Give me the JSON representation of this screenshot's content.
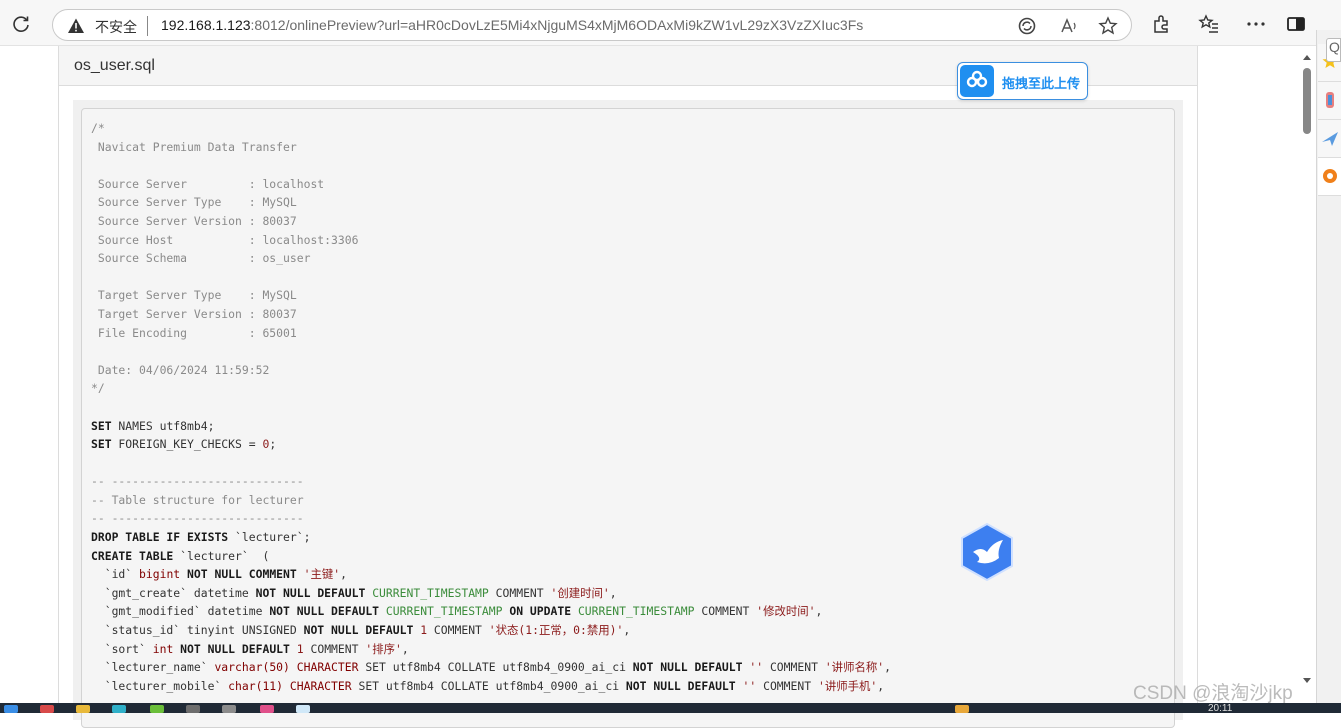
{
  "browser": {
    "security_label": "不安全",
    "url_host": "192.168.1.123",
    "url_rest": ":8012/onlinePreview?url=aHR0cDovLzE5Mi4xNjguMS4xMjM6ODAxMi9kZW1vL29zX3VzZXIuc3Fs",
    "side_search_text": "Q"
  },
  "page": {
    "file_title": "os_user.sql",
    "upload_label": "拖拽至此上传"
  },
  "code": {
    "l01": "/*",
    "l02": " Navicat Premium Data Transfer",
    "l03": "",
    "l04": " Source Server         : localhost",
    "l05": " Source Server Type    : MySQL",
    "l06": " Source Server Version : 80037",
    "l07": " Source Host           : localhost:3306",
    "l08": " Source Schema         : os_user",
    "l09": "",
    "l10": " Target Server Type    : MySQL",
    "l11": " Target Server Version : 80037",
    "l12": " File Encoding         : 65001",
    "l13": "",
    "l14": " Date: 04/06/2024 11:59:52",
    "l15": "*/",
    "set_names_kw": "SET",
    "set_names_rest": " NAMES utf8mb4;",
    "set_fk_kw": "SET",
    "set_fk_rest": " FOREIGN_KEY_CHECKS = ",
    "set_fk_val": "0",
    "set_fk_end": ";",
    "c1": "-- ----------------------------",
    "c2": "-- Table structure for lecturer",
    "c3": "-- ----------------------------",
    "drop_kw": "DROP TABLE IF EXISTS",
    "drop_rest": " `lecturer`;",
    "create_kw": "CREATE TABLE",
    "create_rest": " `lecturer`  (",
    "id_col": "  `id` ",
    "id_type": "bigint",
    "id_kw": " NOT NULL COMMENT ",
    "id_cm": "'主键'",
    "comma": ",",
    "gc_col": "  `gmt_create` datetime ",
    "gc_kw": "NOT NULL DEFAULT ",
    "gc_fn": "CURRENT_TIMESTAMP",
    "gc_kw2": " COMMENT ",
    "gc_cm": "'创建时间'",
    "gm_col": "  `gmt_modified` datetime ",
    "gm_kw": "NOT NULL DEFAULT ",
    "gm_fn": "CURRENT_TIMESTAMP",
    "gm_kw2": " ON UPDATE ",
    "gm_fn2": "CURRENT_TIMESTAMP",
    "gm_kw3": " COMMENT ",
    "gm_cm": "'修改时间'",
    "st_col": "  `status_id` tinyint UNSIGNED ",
    "st_kw": "NOT NULL DEFAULT ",
    "st_num": "1",
    "st_kw2": " COMMENT ",
    "st_cm": "'状态(1:正常，0:禁用)'",
    "so_col": "  `sort` ",
    "so_type": "int",
    "so_kw": " NOT NULL DEFAULT ",
    "so_num": "1",
    "so_kw2": " COMMENT ",
    "so_cm": "'排序'",
    "ln_col": "  `lecturer_name` ",
    "ln_type": "varchar(50)",
    "ln_cs": " CHARACTER",
    "ln_mid": " SET utf8mb4 COLLATE utf8mb4_0900_ai_ci ",
    "ln_kw": "NOT NULL DEFAULT ",
    "ln_def": "''",
    "ln_kw2": " COMMENT ",
    "ln_cm": "'讲师名称'",
    "lm_col": "  `lecturer_mobile` ",
    "lm_type": "char(11)",
    "lm_cs": " CHARACTER",
    "lm_mid": " SET utf8mb4 COLLATE utf8mb4_0900_ai_ci ",
    "lm_kw": "NOT NULL DEFAULT ",
    "lm_def": "''",
    "lm_kw2": " COMMENT ",
    "lm_cm": "'讲师手机'"
  },
  "watermark": "CSDN @浪淘沙jkp",
  "taskbar": {
    "clock": "20:11"
  },
  "colors": {
    "accent": "#1f8ff0",
    "toolbar": "#f7f7f7"
  }
}
